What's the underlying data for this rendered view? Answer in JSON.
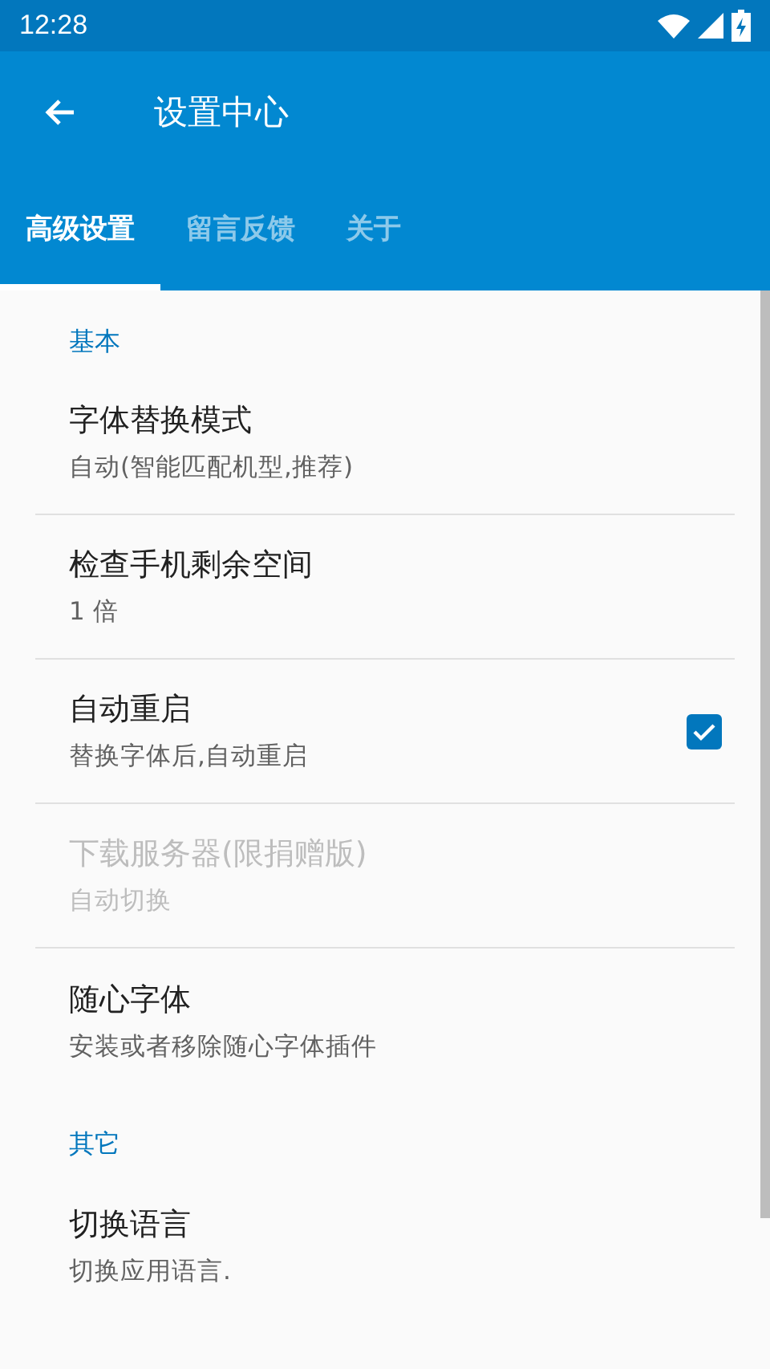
{
  "status_bar": {
    "time": "12:28"
  },
  "app_bar": {
    "title": "设置中心"
  },
  "tabs": [
    {
      "label": "高级设置",
      "selected": true
    },
    {
      "label": "留言反馈",
      "selected": false
    },
    {
      "label": "关于",
      "selected": false
    }
  ],
  "sections": [
    {
      "header": "基本",
      "items": [
        {
          "kind": "text",
          "title": "字体替换模式",
          "summary": "自动(智能匹配机型,推荐)",
          "disabled": false
        },
        {
          "kind": "text",
          "title": "检查手机剩余空间",
          "summary": "1 倍",
          "disabled": false
        },
        {
          "kind": "checkbox",
          "title": "自动重启",
          "summary": "替换字体后,自动重启",
          "disabled": false,
          "checked": true
        },
        {
          "kind": "text",
          "title": "下载服务器(限捐赠版)",
          "summary": "自动切换",
          "disabled": true
        },
        {
          "kind": "text",
          "title": "随心字体",
          "summary": "安装或者移除随心字体插件",
          "disabled": false
        }
      ]
    },
    {
      "header": "其它",
      "items": [
        {
          "kind": "text",
          "title": "切换语言",
          "summary": "切换应用语言.",
          "disabled": false
        }
      ]
    }
  ]
}
